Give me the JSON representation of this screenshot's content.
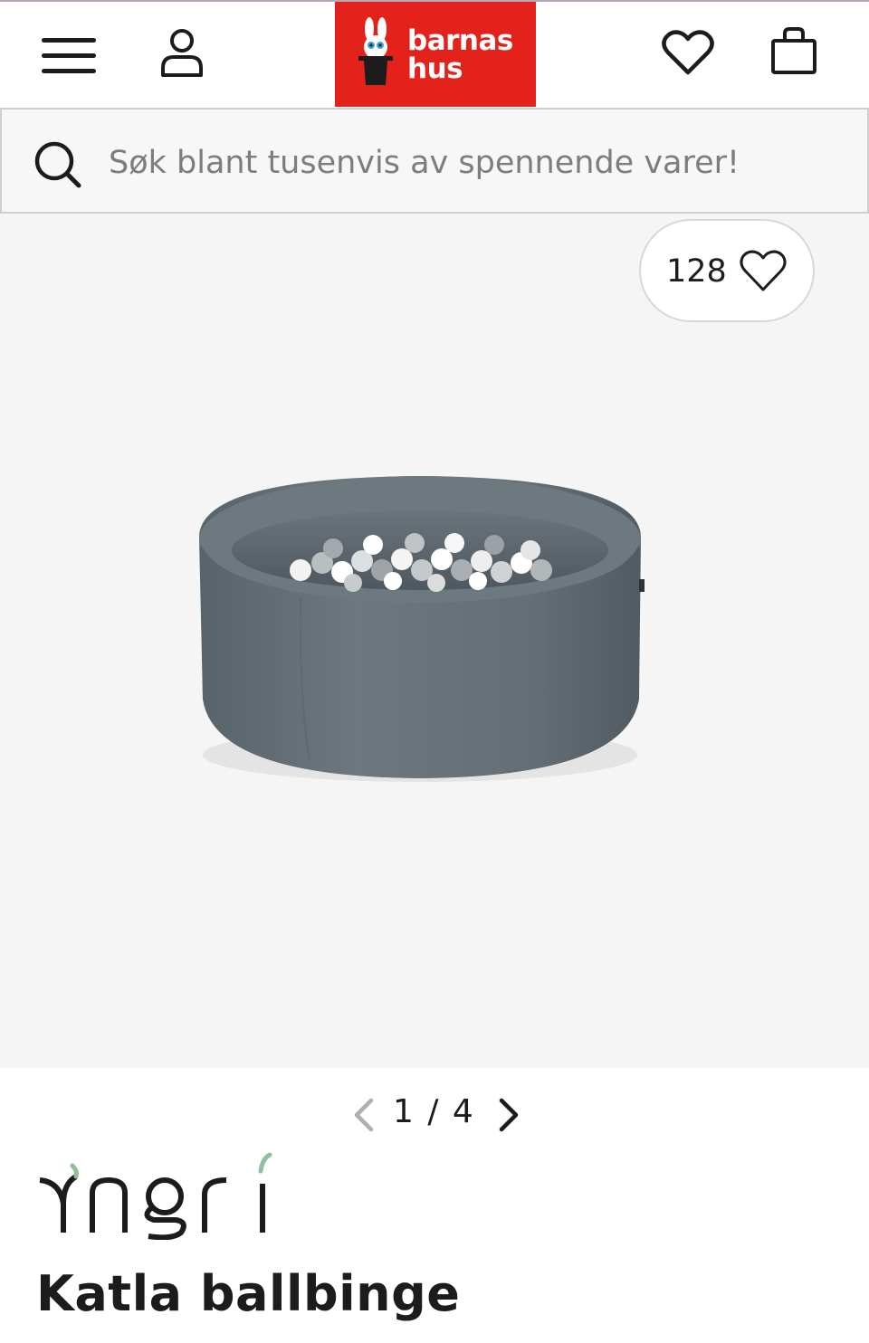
{
  "header": {
    "logo_lines": [
      "barnas",
      "hus"
    ],
    "icons": [
      "menu-icon",
      "user-icon",
      "heart-icon",
      "shopping-bag-icon"
    ],
    "brand_color": "#e3231b"
  },
  "search": {
    "placeholder": "Søk blant tusenvis av spennende varer!"
  },
  "gallery": {
    "like_count": "128",
    "current": 1,
    "total": 4,
    "pager_text": "1 / 4"
  },
  "product": {
    "brand_logo_text": "Yngri",
    "title": "Katla ballbinge"
  }
}
